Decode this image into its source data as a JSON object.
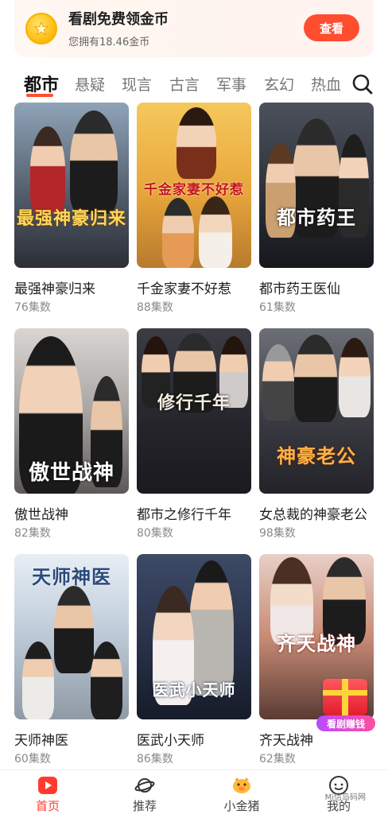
{
  "banner": {
    "title": "看剧免费领金币",
    "subtitle": "您拥有18.46金币",
    "button_label": "查看"
  },
  "tabs": [
    {
      "label": "都市",
      "active": true
    },
    {
      "label": "悬疑",
      "active": false
    },
    {
      "label": "现言",
      "active": false
    },
    {
      "label": "古言",
      "active": false
    },
    {
      "label": "军事",
      "active": false
    },
    {
      "label": "玄幻",
      "active": false
    },
    {
      "label": "热血",
      "active": false
    }
  ],
  "dramas": [
    {
      "title": "最强神豪归来",
      "episodes": "76集数",
      "poster_text": "最强神豪归来",
      "poster_color": "#5d6a78"
    },
    {
      "title": "千金家妻不好惹",
      "episodes": "88集数",
      "poster_text": "千金家妻不好惹",
      "poster_color": "#e7b24a"
    },
    {
      "title": "都市药王医仙",
      "episodes": "61集数",
      "poster_text": "都市药王",
      "poster_color": "#3a3f4b"
    },
    {
      "title": "傲世战神",
      "episodes": "82集数",
      "poster_text": "傲世战神",
      "poster_color": "#8c8a8a"
    },
    {
      "title": "都市之修行千年",
      "episodes": "80集数",
      "poster_text": "修行千年",
      "poster_color": "#2e2e36"
    },
    {
      "title": "女总裁的神豪老公",
      "episodes": "98集数",
      "poster_text": "神豪老公",
      "poster_color": "#3e3d44"
    },
    {
      "title": "天师神医",
      "episodes": "60集数",
      "poster_text": "天师神医",
      "poster_color": "#c9d4df"
    },
    {
      "title": "医武小天师",
      "episodes": "86集数",
      "poster_text": "医武小天师",
      "poster_color": "#2b3550"
    },
    {
      "title": "齐天战神",
      "episodes": "62集数",
      "poster_text": "齐天战神",
      "poster_color": "#c98b76"
    }
  ],
  "earn_badge": {
    "label": "看剧赚钱"
  },
  "bottom_nav": [
    {
      "label": "首页",
      "icon": "play-icon",
      "active": true
    },
    {
      "label": "推荐",
      "icon": "planet-icon",
      "active": false
    },
    {
      "label": "小金猪",
      "icon": "piggy-icon",
      "active": false
    },
    {
      "label": "我的",
      "icon": "profile-icon",
      "active": false
    }
  ],
  "watermark": "Mi信岛码网",
  "colors": {
    "accent": "#ff4e2f",
    "active_nav": "#ff3b30"
  }
}
